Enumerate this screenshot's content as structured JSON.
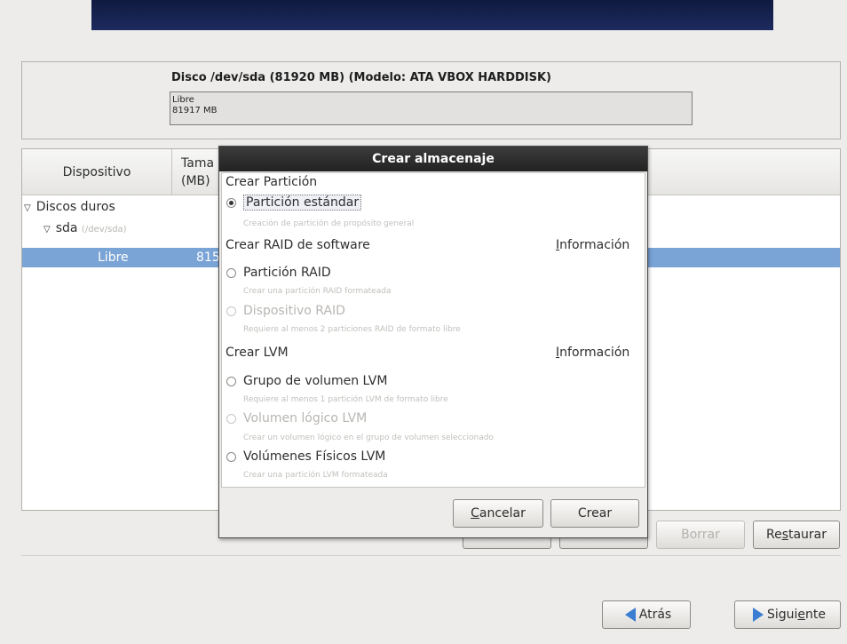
{
  "disk": {
    "title": "Disco /dev/sda (81920 MB) (Modelo: ATA VBOX HARDDISK)",
    "free_label": "Libre",
    "free_size": "81917 MB"
  },
  "tree": {
    "col_device": "Dispositivo",
    "col_size_1": "Tama",
    "col_size_2": "(MB)",
    "rows": [
      {
        "label": "Discos duros"
      },
      {
        "label": "sda",
        "sub": "(/dev/sda)"
      },
      {
        "label": "Libre",
        "size": "815"
      }
    ]
  },
  "actions": {
    "delete": "Borrar",
    "reset_pre": "Re",
    "reset_key": "s",
    "reset_post": "taurar"
  },
  "nav": {
    "back": "Atrás",
    "next_pre": "Sigui",
    "next_key": "e",
    "next_post": "nte"
  },
  "dialog": {
    "title": "Crear almacenaje",
    "sec_partition": "Crear Partición",
    "opt_standard": "Partición estándar",
    "desc_standard": "Creación de partición de propósito general",
    "sec_raid": "Crear RAID de software",
    "info_key": "I",
    "info_rest": "nformación",
    "opt_raid_part": "Partición RAID",
    "desc_raid_part": "Crear una partición RAID formateada",
    "opt_raid_dev": "Dispositivo RAID",
    "desc_raid_dev": "Requiere al menos 2 particiones RAID de formato libre",
    "sec_lvm": "Crear LVM",
    "opt_lvm_group": "Grupo de volumen LVM",
    "desc_lvm_group": "Requiere al menos 1 partición LVM de formato libre",
    "opt_lvm_logical": "Volumen lógico LVM",
    "desc_lvm_logical": "Crear un volumen lógico en el grupo de volumen seleccionado",
    "opt_lvm_phys": "Volúmenes Físicos LVM",
    "desc_lvm_phys": "Crear una partición LVM formateada",
    "cancel_key": "C",
    "cancel_rest": "ancelar",
    "create": "Crear"
  }
}
